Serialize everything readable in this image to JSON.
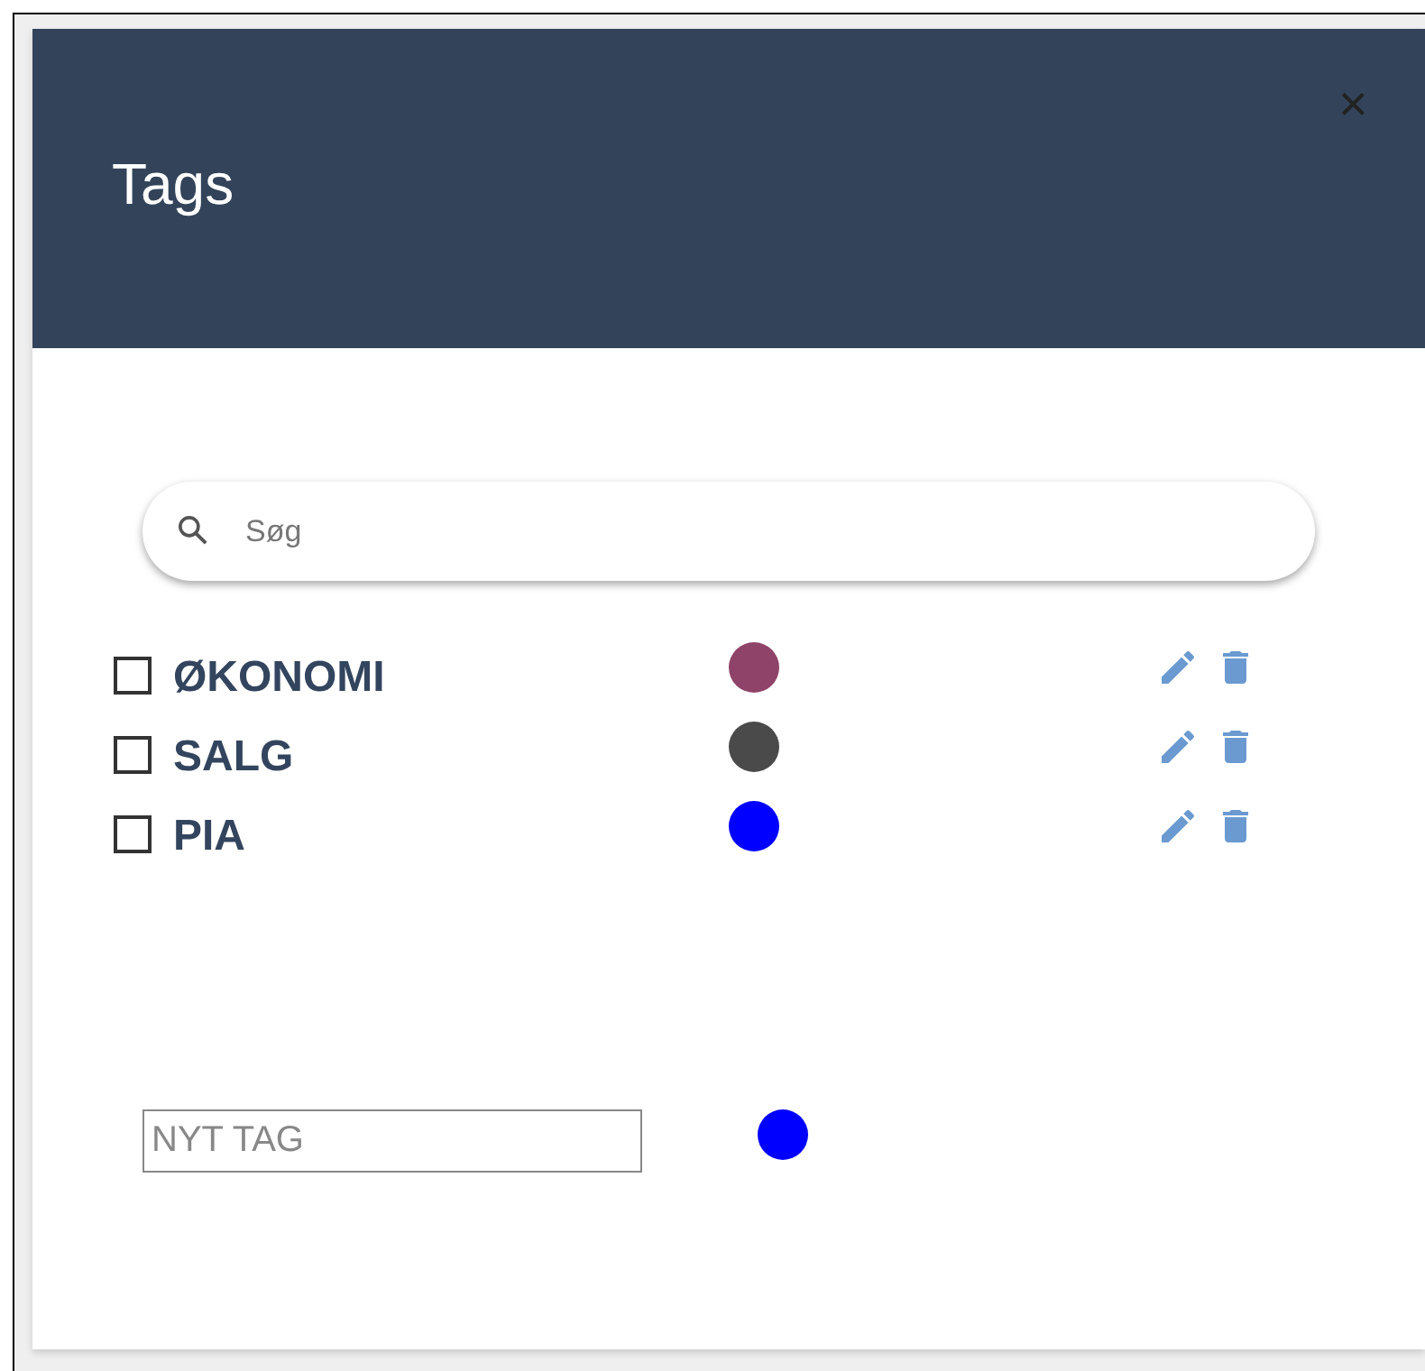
{
  "dialog": {
    "title": "Tags",
    "close": "×"
  },
  "search": {
    "placeholder": "Søg"
  },
  "tags": [
    {
      "label": "ØKONOMI",
      "checked": false,
      "color": "#8f4368"
    },
    {
      "label": "SALG",
      "checked": false,
      "color": "#4a4a4a"
    },
    {
      "label": "PIA",
      "checked": false,
      "color": "#0000ff"
    }
  ],
  "new_tag": {
    "placeholder": "NYT TAG",
    "color": "#0000ff"
  }
}
